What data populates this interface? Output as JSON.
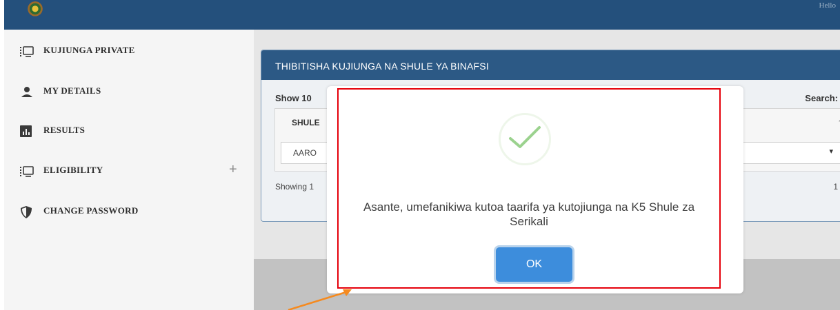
{
  "header": {
    "logo_icon": "coat-of-arms-logo",
    "user_name": "Hello"
  },
  "sidebar": {
    "items": [
      {
        "label": "KUJIUNGA PRIVATE",
        "icon": "monitor-list-icon"
      },
      {
        "label": "MY DETAILS",
        "icon": "person-icon"
      },
      {
        "label": "RESULTS",
        "icon": "bar-chart-icon"
      },
      {
        "label": "ELIGIBILITY",
        "icon": "monitor-list-icon",
        "expand": "+"
      },
      {
        "label": "CHANGE PASSWORD",
        "icon": "shield-icon"
      }
    ]
  },
  "main": {
    "card_title": "THIBITISHA KUJIUNGA NA SHULE YA BINAFSI",
    "show_text": "Show 10",
    "search_text": "Search:",
    "table": {
      "column_header": "SHULE",
      "row_value": "AARO",
      "row_caret": "▾"
    },
    "showing_text": "Showing 1",
    "pager_mark": "1"
  },
  "modal": {
    "icon": "success-check-icon",
    "message": "Asante, umefanikiwa kutoa taarifa ya kutojiunga na K5 Shule za Serikali",
    "ok_label": "OK"
  },
  "colors": {
    "header": "#24507c",
    "card_header": "#2c5985",
    "ok_button": "#3d8ddc",
    "highlight_box": "#e5000a",
    "annotation_arrow": "#f58a1f",
    "checkmark": "#9bd28e"
  }
}
